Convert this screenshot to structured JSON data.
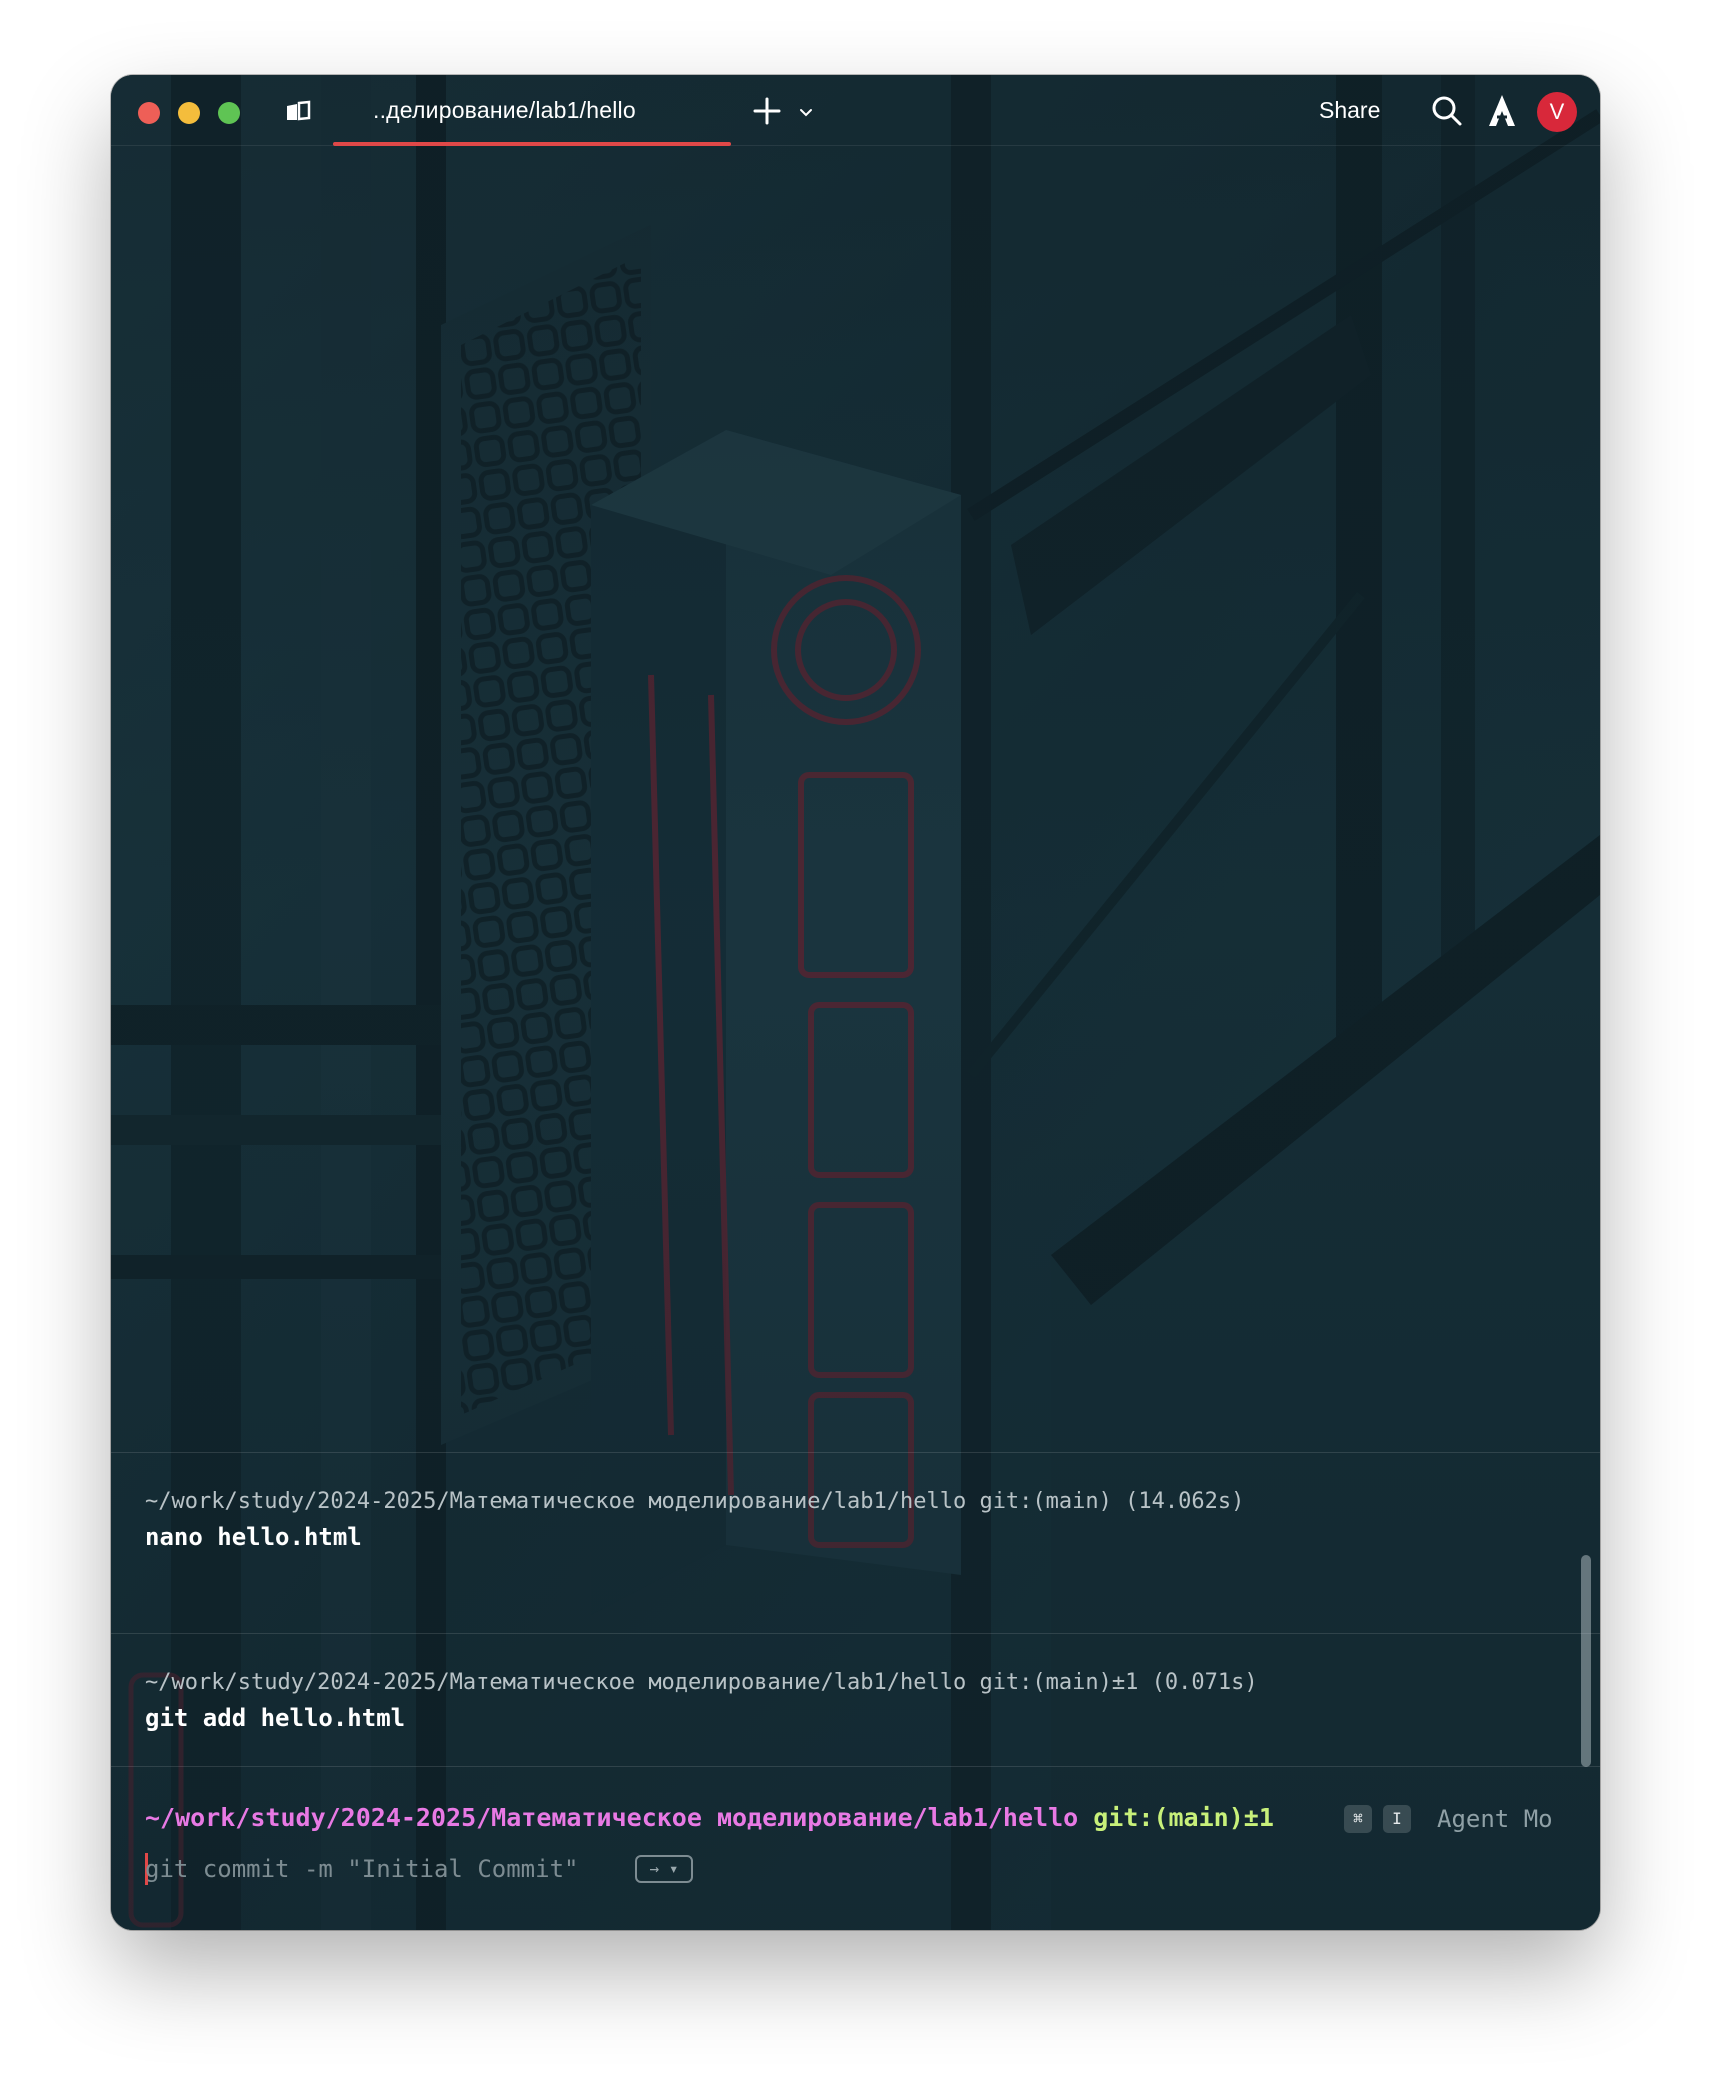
{
  "window": {
    "tab_title": "..делирование/lab1/hello",
    "share_label": "Share",
    "avatar_initial": "V",
    "icons": [
      "close-traffic-light",
      "minimize-traffic-light",
      "maximize-traffic-light",
      "sidebar-toggle-icon",
      "plus-icon",
      "chevron-down-icon",
      "search-icon",
      "agent-logo-icon"
    ]
  },
  "terminal": {
    "blocks": [
      {
        "meta": "~/work/study/2024-2025/Математическое моделирование/lab1/hello git:(main) (14.062s)",
        "command": "nano hello.html"
      },
      {
        "meta": "~/work/study/2024-2025/Математическое моделирование/lab1/hello git:(main)±1 (0.071s)",
        "command": "git add hello.html"
      }
    ],
    "prompt": {
      "path": "~/work/study/2024-2025/Математическое моделирование/lab1/hello",
      "git": "git:(main)±1",
      "kbd_cmd": "⌘",
      "kbd_i": "I",
      "agent_mode": "Agent Mo",
      "suggestion": "git commit -m \"Initial Commit\"",
      "accept_hint": "→ ▾"
    }
  },
  "colors": {
    "accent": "#e04848",
    "prompt_path": "#e879e4",
    "prompt_git": "#c8f07a",
    "avatar": "#d8283a"
  }
}
